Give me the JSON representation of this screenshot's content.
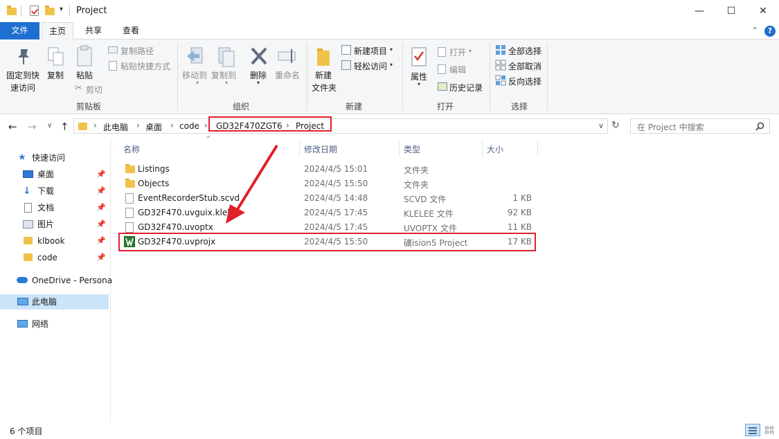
{
  "window": {
    "title": "Project",
    "minimize_glyph": "—",
    "maximize_glyph": "☐",
    "close_glyph": "✕",
    "quick_access_chevron": "▾"
  },
  "tabs": [
    {
      "label": "文件"
    },
    {
      "label": "主页"
    },
    {
      "label": "共享"
    },
    {
      "label": "查看"
    }
  ],
  "ribbon": {
    "collapse_glyph": "⌃",
    "help_glyph": "?",
    "clipboard": {
      "pin_label_line1": "固定到快",
      "pin_label_line2": "速访问",
      "copy_label": "复制",
      "paste_label": "粘贴",
      "copy_path_label": "复制路径",
      "paste_shortcut_label": "粘贴快捷方式",
      "cut_label": "剪切",
      "group_label": "剪贴板"
    },
    "organize": {
      "move_to_label": "移动到",
      "copy_to_label": "复制到",
      "delete_label": "删除",
      "rename_label": "重命名",
      "group_label": "组织"
    },
    "new": {
      "new_folder_line1": "新建",
      "new_folder_line2": "文件夹",
      "new_item_label": "新建项目",
      "easy_access_label": "轻松访问",
      "group_label": "新建"
    },
    "open": {
      "properties_label": "属性",
      "open_label": "打开",
      "edit_label": "编辑",
      "history_label": "历史记录",
      "group_label": "打开"
    },
    "select": {
      "select_all_label": "全部选择",
      "select_none_label": "全部取消",
      "invert_label": "反向选择",
      "group_label": "选择"
    }
  },
  "address": {
    "breadcrumbs": [
      "此电脑",
      "桌面",
      "code",
      "GD32F470ZGT6",
      "Project"
    ],
    "separator": "›",
    "dropdown_glyph": "∨",
    "refresh_glyph": "↻",
    "search_placeholder": "在 Project 中搜索"
  },
  "nav": {
    "quick_access": "快速访问",
    "items": [
      {
        "label": "桌面",
        "icon": "desktop-icon"
      },
      {
        "label": "下载",
        "icon": "download-icon"
      },
      {
        "label": "文档",
        "icon": "document-icon"
      },
      {
        "label": "图片",
        "icon": "pictures-icon"
      },
      {
        "label": "klbook",
        "icon": "folder-icon"
      },
      {
        "label": "code",
        "icon": "folder-icon"
      }
    ],
    "onedrive": "OneDrive - Persona",
    "this_pc": "此电脑",
    "network": "网络"
  },
  "columns": {
    "name": "名称",
    "modified": "修改日期",
    "type": "类型",
    "size": "大小"
  },
  "files": [
    {
      "name": "Listings",
      "modified": "2024/4/5 15:01",
      "type": "文件夹",
      "size": "",
      "kind": "folder"
    },
    {
      "name": "Objects",
      "modified": "2024/4/5 15:50",
      "type": "文件夹",
      "size": "",
      "kind": "folder"
    },
    {
      "name": "EventRecorderStub.scvd",
      "modified": "2024/4/5 14:48",
      "type": "SCVD 文件",
      "size": "1 KB",
      "kind": "file"
    },
    {
      "name": "GD32F470.uvguix.klele",
      "modified": "2024/4/5 17:45",
      "type": "KLELEE 文件",
      "size": "92 KB",
      "kind": "file"
    },
    {
      "name": "GD32F470.uvoptx",
      "modified": "2024/4/5 17:45",
      "type": "UVOPTX 文件",
      "size": "11 KB",
      "kind": "file"
    },
    {
      "name": "GD32F470.uvprojx",
      "modified": "2024/4/5 15:50",
      "type": "礦ision5 Project",
      "size": "17 KB",
      "kind": "uvproj"
    }
  ],
  "status": {
    "count": "6 个项目"
  },
  "colors": {
    "accent": "#1e6fd0",
    "highlight": "#e1202a",
    "selection": "#cce4f7"
  }
}
